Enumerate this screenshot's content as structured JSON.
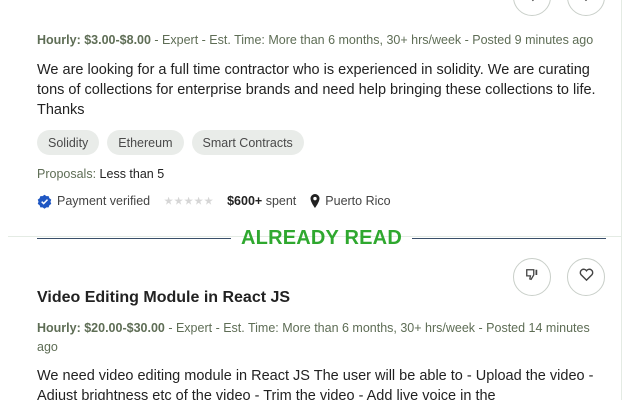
{
  "job1": {
    "meta_rate": "Hourly: $3.00-$8.00",
    "meta_rest": " - Expert - Est. Time: More than 6 months, 30+ hrs/week - Posted 9 minutes ago",
    "description": "We are looking for a full time contractor who is experienced in solidity. We are curating tons of collections for enterprise brands and need help bringing these collections to life. Thanks",
    "tags": [
      "Solidity",
      "Ethereum",
      "Smart Contracts"
    ],
    "proposals_label": "Proposals:",
    "proposals_value": "Less than 5",
    "payment": "Payment verified",
    "rating": 0,
    "spent": "$600+",
    "spent_suffix": " spent",
    "location": "Puerto Rico"
  },
  "banner": {
    "text": "ALREADY READ",
    "color": "#2fa82f"
  },
  "job2": {
    "title": "Video Editing Module in React JS",
    "meta_rate": "Hourly: $20.00-$30.00",
    "meta_rest": " - Expert - Est. Time: More than 6 months, 30+ hrs/week - Posted 14 minutes ago",
    "description": "We need video editing module in React JS The user will be able to - Upload the video - Adjust brightness etc of the video - Trim the video - Add live voice in the"
  },
  "icons": {
    "dislike": "thumbs-down-icon",
    "save": "heart-icon",
    "verified": "verified-badge-icon",
    "location": "location-pin-icon"
  }
}
